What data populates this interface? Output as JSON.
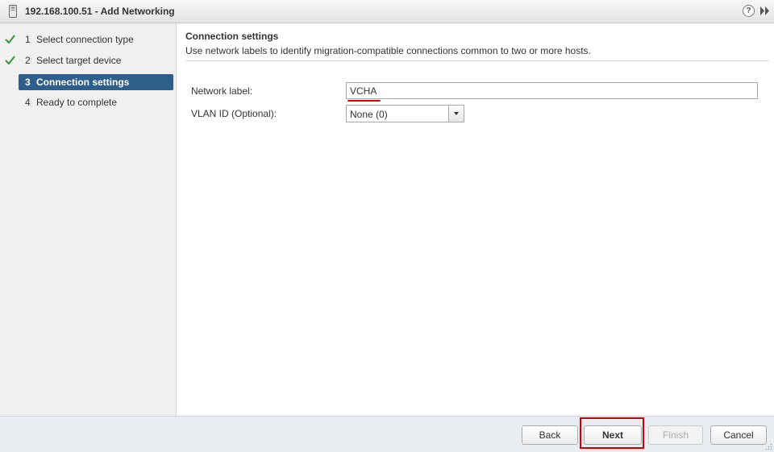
{
  "window": {
    "title": "192.168.100.51 - Add Networking",
    "help_glyph": "?"
  },
  "steps": [
    {
      "num": "1",
      "label": "Select connection type",
      "state": "done"
    },
    {
      "num": "2",
      "label": "Select target device",
      "state": "done"
    },
    {
      "num": "3",
      "label": "Connection settings",
      "state": "active"
    },
    {
      "num": "4",
      "label": "Ready to complete",
      "state": "pending"
    }
  ],
  "section": {
    "title": "Connection settings",
    "description": "Use network labels to identify migration-compatible connections common to two or more hosts."
  },
  "form": {
    "network_label": {
      "label": "Network label:",
      "value": "VCHA"
    },
    "vlan_id": {
      "label": "VLAN ID (Optional):",
      "value": "None (0)"
    }
  },
  "buttons": {
    "back": "Back",
    "next": "Next",
    "finish": "Finish",
    "cancel": "Cancel"
  },
  "colors": {
    "active_step": "#2d5f8a",
    "check": "#3c9d3c",
    "highlight": "#d40000"
  },
  "icons": [
    "host-icon",
    "help-icon",
    "expand-icon",
    "check-icon",
    "dropdown-arrow-icon",
    "resize-grip-icon"
  ]
}
